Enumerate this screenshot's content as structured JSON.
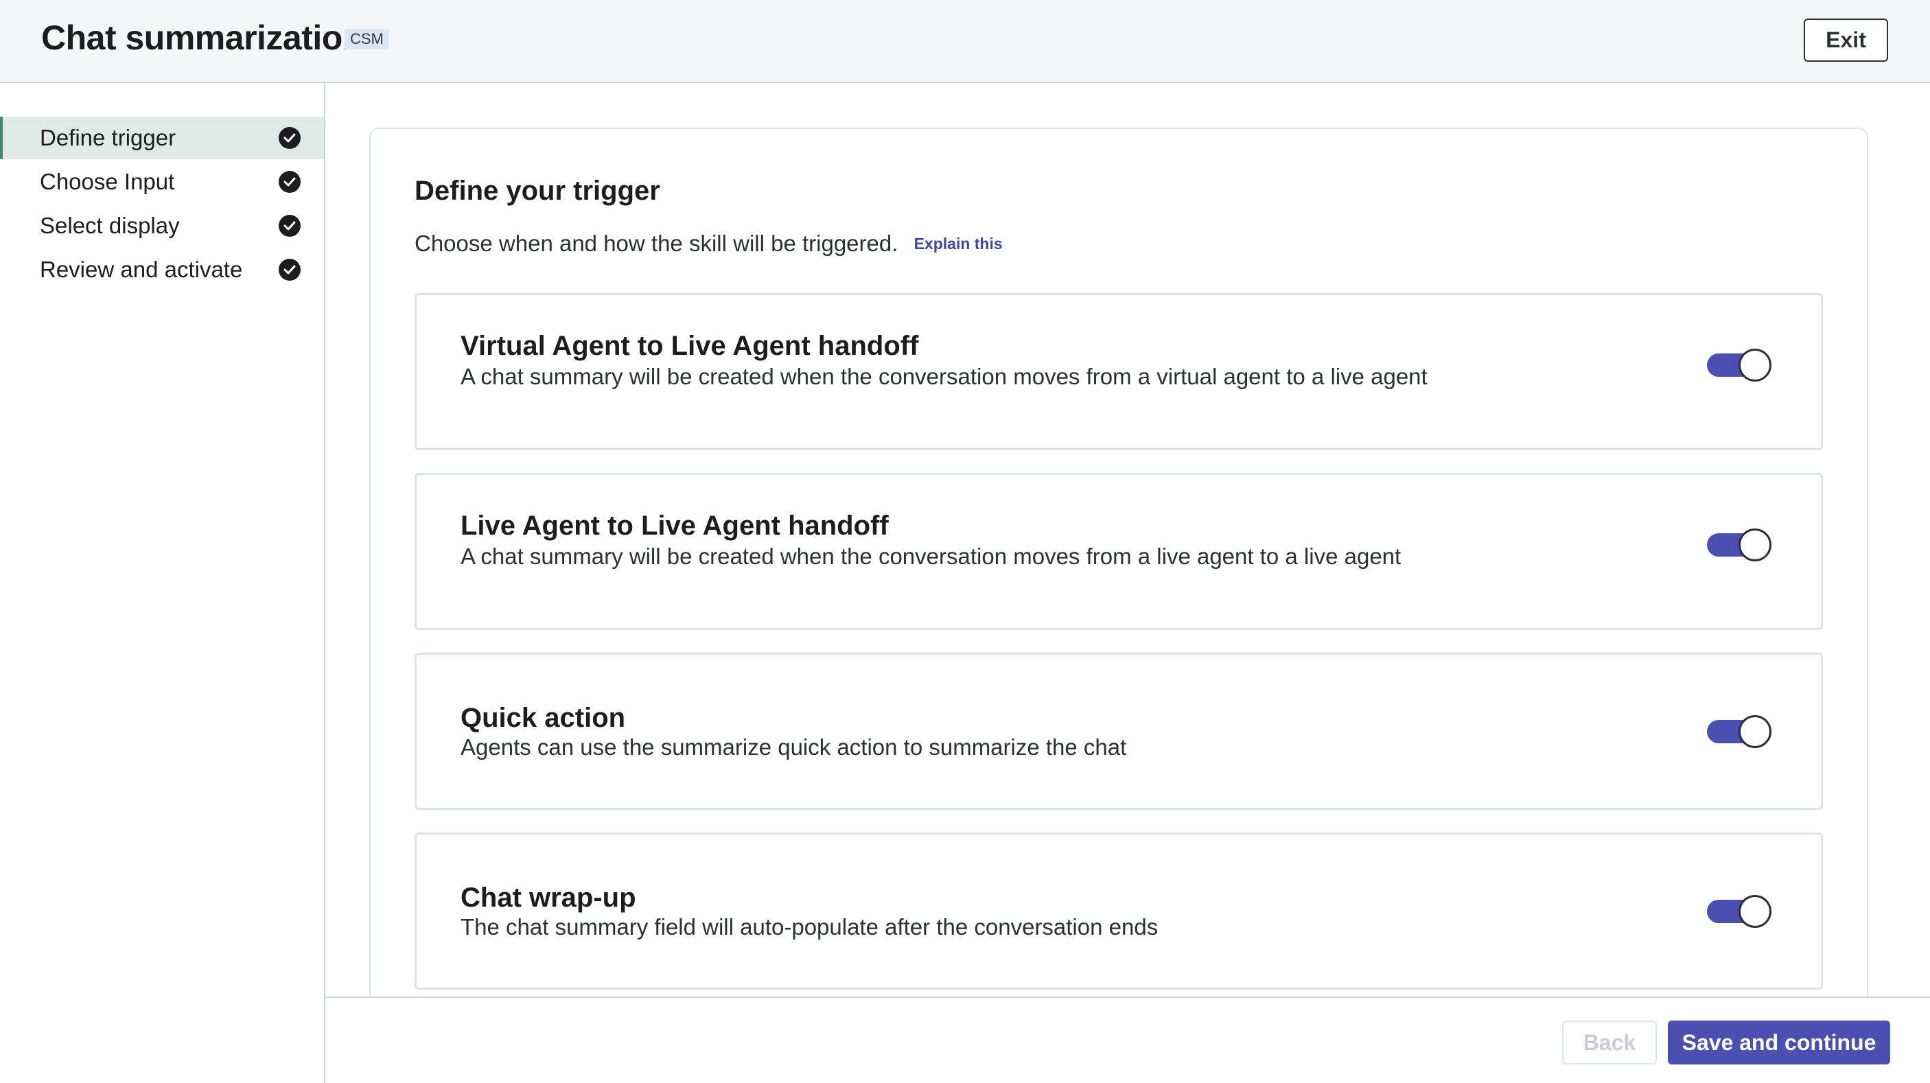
{
  "header": {
    "title": "Chat summarization",
    "badge": "CSM",
    "exit_label": "Exit"
  },
  "sidebar": {
    "items": [
      {
        "label": "Define trigger",
        "active": true,
        "icon": "check-circle-icon"
      },
      {
        "label": "Choose Input",
        "active": false,
        "icon": "check-circle-icon"
      },
      {
        "label": "Select display",
        "active": false,
        "icon": "check-circle-icon"
      },
      {
        "label": "Review and activate",
        "active": false,
        "icon": "check-circle-icon"
      }
    ]
  },
  "main": {
    "title": "Define your trigger",
    "description": "Choose when and how the skill will be triggered.",
    "explain_link": "Explain this",
    "triggers": [
      {
        "title": "Virtual Agent to Live Agent handoff",
        "description": "A chat summary will be created when the conversation moves from a virtual agent to a live agent",
        "enabled": true
      },
      {
        "title": "Live Agent to Live Agent handoff",
        "description": "A chat summary will be created when the conversation moves from a live agent to a live agent",
        "enabled": true
      },
      {
        "title": "Quick action",
        "description": "Agents can use the summarize quick action to summarize the chat",
        "enabled": true
      },
      {
        "title": "Chat wrap-up",
        "description": "The chat summary field will auto-populate after the conversation ends",
        "enabled": true
      }
    ]
  },
  "footer": {
    "back_label": "Back",
    "save_label": "Save and continue"
  },
  "colors": {
    "accent": "#4b4fb0",
    "active_nav": "#ddeae5",
    "active_nav_border": "#3d8a6e",
    "link": "#3f46a6"
  }
}
